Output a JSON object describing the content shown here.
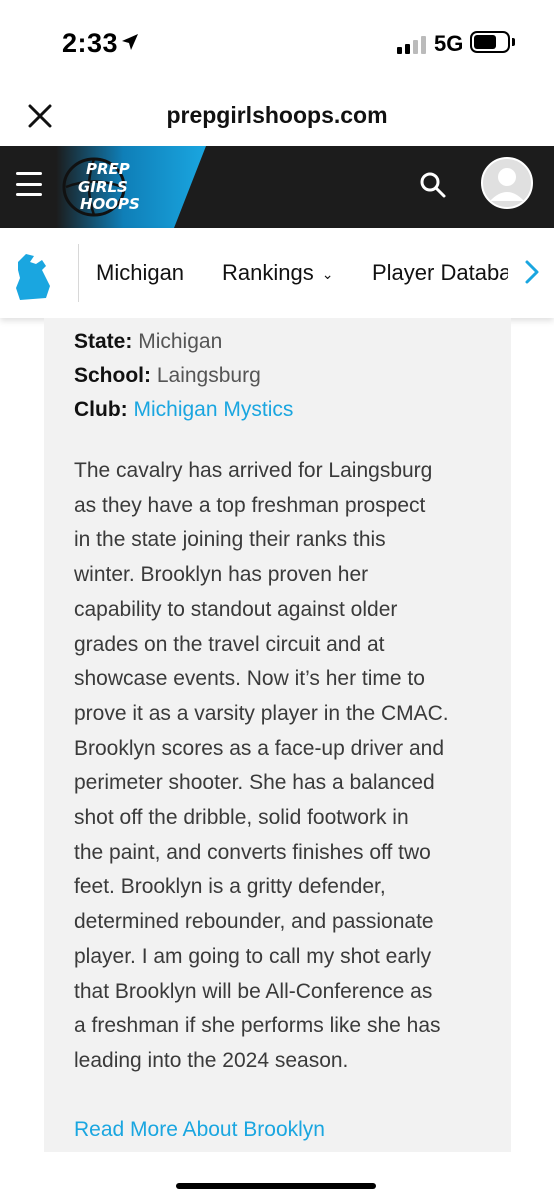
{
  "status_bar": {
    "time": "2:33",
    "network": "5G",
    "icons": [
      "location-arrow-icon",
      "signal-icon",
      "battery-icon"
    ]
  },
  "browser": {
    "url": "prepgirlshoops.com",
    "close_icon": "close-icon"
  },
  "site_header": {
    "logo": {
      "line1": "PREP",
      "line2": "GIRLS",
      "line3": "HOOPS"
    },
    "icons": [
      "menu-icon",
      "search-icon",
      "avatar-icon"
    ],
    "colors": {
      "background": "#1c1c1c",
      "accent": "#1aa6e0"
    }
  },
  "subnav": {
    "state_icon": "michigan-state-icon",
    "items": [
      {
        "label": "Michigan"
      },
      {
        "label": "Rankings"
      },
      {
        "label": "Player Databa"
      }
    ],
    "scroll_icon": "chevron-right-icon"
  },
  "profile": {
    "state_label": "State:",
    "state_value": "Michigan",
    "school_label": "School:",
    "school_value": "Laingsburg",
    "club_label": "Club:",
    "club_value": "Michigan Mystics",
    "bio_lines": [
      "The cavalry has arrived for Laingsburg",
      "as they have a top freshman prospect",
      "in the state joining their ranks this",
      "winter. Brooklyn has proven her",
      "capability to standout against older",
      "grades on the travel circuit and at",
      "showcase events. Now it’s her time to",
      "prove it as a varsity player in the CMAC.",
      "Brooklyn scores as a face-up driver and",
      "perimeter shooter. She has a balanced",
      "shot off the dribble, solid footwork in",
      "the paint, and converts finishes off two",
      "feet. Brooklyn is a gritty defender,",
      "determined rebounder, and passionate",
      "player. I am going to call my shot early",
      "that Brooklyn will be All-Conference as",
      "a freshman if she performs like she has",
      "leading into the 2024 season."
    ],
    "read_more": "Read More About Brooklyn"
  }
}
